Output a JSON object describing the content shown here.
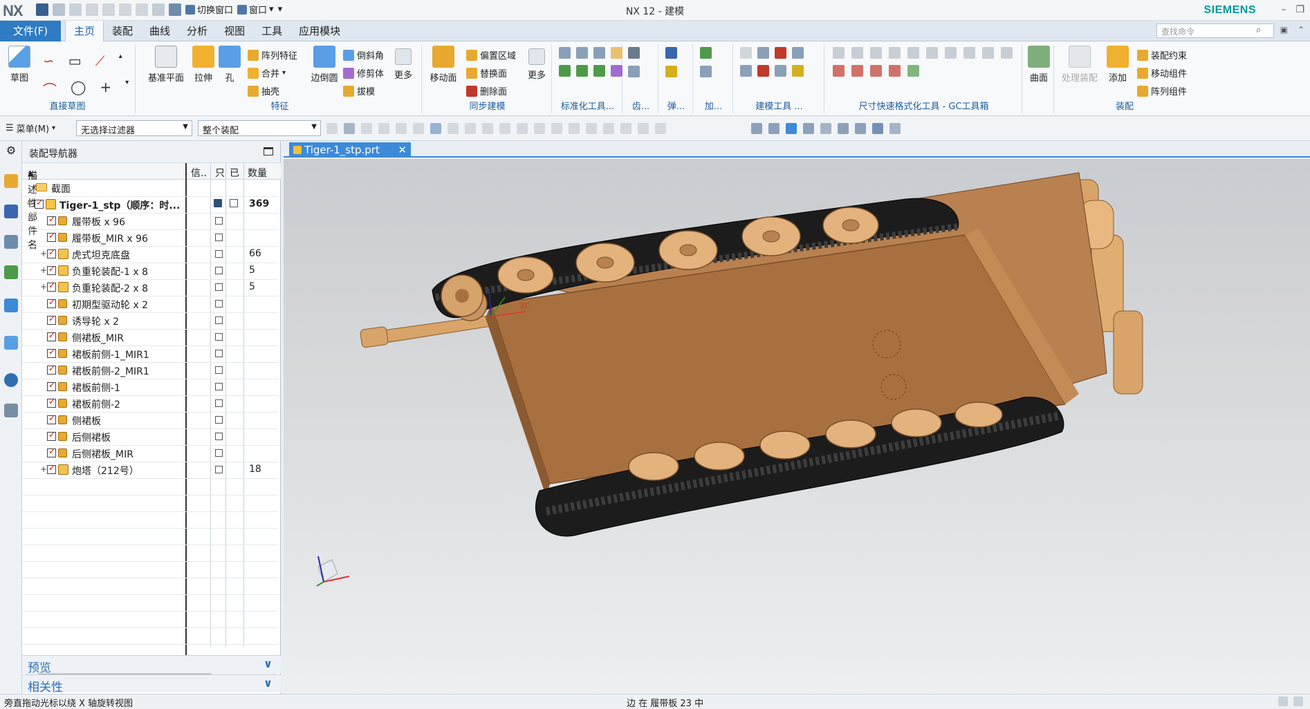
{
  "app": {
    "logo": "NX",
    "window_title": "NX 12 - 建模",
    "brand": "SIEMENS",
    "quick_access": {
      "switch_window": "切换窗口",
      "window_menu": "窗口"
    }
  },
  "tabs": {
    "file": "文件(F)",
    "items": [
      "主页",
      "装配",
      "曲线",
      "分析",
      "视图",
      "工具",
      "应用模块"
    ],
    "active_index": 0,
    "search_placeholder": "查找命令"
  },
  "ribbon": {
    "sketch": {
      "label": "草图",
      "group": "直接草图"
    },
    "feature": {
      "datum_plane": "基准平面",
      "extrude": "拉伸",
      "hole": "孔",
      "pattern": "阵列特征",
      "unite": "合并",
      "shell": "抽壳",
      "edge_blend": "边倒圆",
      "chamfer": "倒斜角",
      "trim_body": "修剪体",
      "draft": "拔模",
      "more": "更多",
      "group": "特征"
    },
    "sync": {
      "move_face": "移动面",
      "offset_region": "偏置区域",
      "replace_face": "替换面",
      "delete_face": "删除面",
      "more": "更多",
      "group": "同步建模"
    },
    "small_groups": [
      "标准化工具...",
      "齿...",
      "弹...",
      "加...",
      "建模工具 ...",
      "尺寸快速格式化工具 - GC工具箱"
    ],
    "surface": {
      "label": "曲面"
    },
    "assembly": {
      "process": "处理装配",
      "add": "添加",
      "constraint": "装配约束",
      "move_component": "移动组件",
      "pattern_component": "阵列组件",
      "group": "装配"
    }
  },
  "toolbar2": {
    "menu": "菜单(M)",
    "filter": "无选择过滤器",
    "scope": "整个装配"
  },
  "navigator": {
    "title": "装配导航器",
    "columns": {
      "name": "描述性部件名",
      "info": "信..",
      "read_only": "只",
      "modified": "已",
      "quantity": "数量"
    },
    "rows": [
      {
        "name": "截面",
        "level": 0,
        "type": "folder",
        "qty": ""
      },
      {
        "name": "Tiger-1_stp（顺序：时...",
        "level": 0,
        "type": "root",
        "qty": "369"
      },
      {
        "name": "履带板 x 96",
        "level": 1,
        "type": "part",
        "qty": ""
      },
      {
        "name": "履带板_MIR x 96",
        "level": 1,
        "type": "part",
        "qty": ""
      },
      {
        "name": "虎式坦克底盘",
        "level": 1,
        "type": "asm",
        "qty": "66"
      },
      {
        "name": "负重轮装配-1 x 8",
        "level": 1,
        "type": "asm",
        "qty": "5"
      },
      {
        "name": "负重轮装配-2 x 8",
        "level": 1,
        "type": "asm",
        "qty": "5"
      },
      {
        "name": "初期型驱动轮 x 2",
        "level": 1,
        "type": "part",
        "qty": ""
      },
      {
        "name": "诱导轮 x 2",
        "level": 1,
        "type": "part",
        "qty": ""
      },
      {
        "name": "侧裙板_MIR",
        "level": 1,
        "type": "part",
        "qty": ""
      },
      {
        "name": "裙板前侧-1_MIR1",
        "level": 1,
        "type": "part",
        "qty": ""
      },
      {
        "name": "裙板前侧-2_MIR1",
        "level": 1,
        "type": "part",
        "qty": ""
      },
      {
        "name": "裙板前侧-1",
        "level": 1,
        "type": "part",
        "qty": ""
      },
      {
        "name": "裙板前侧-2",
        "level": 1,
        "type": "part",
        "qty": ""
      },
      {
        "name": "侧裙板",
        "level": 1,
        "type": "part",
        "qty": ""
      },
      {
        "name": "后侧裙板",
        "level": 1,
        "type": "part",
        "qty": ""
      },
      {
        "name": "后侧裙板_MIR",
        "level": 1,
        "type": "part",
        "qty": ""
      },
      {
        "name": "炮塔（212号）",
        "level": 1,
        "type": "asm",
        "qty": "18"
      }
    ],
    "panels": {
      "preview": "预览",
      "dependencies": "相关性"
    }
  },
  "document": {
    "tab": "Tiger-1_stp.prt",
    "csys_label": "XC"
  },
  "status": {
    "left": "旁直拖动光标以绕 X 轴旋转视图",
    "middle": "边 在 履带板 23 中"
  }
}
